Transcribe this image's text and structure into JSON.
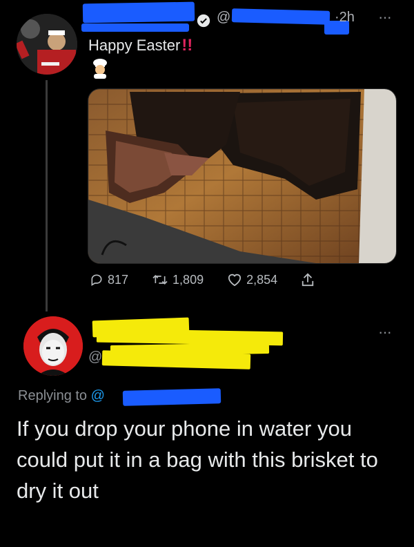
{
  "tweet1": {
    "handle_prefix": "@",
    "time": "·2h",
    "more": "···",
    "text": "Happy Easter",
    "emphasis": "!!",
    "chef_emoji": "cook-emoji",
    "photo_alt": "brisket-on-cutting-board",
    "stats": {
      "replies": "817",
      "retweets": "1,809",
      "likes": "2,854"
    },
    "icons": [
      "reply-icon",
      "retweet-icon",
      "like-icon",
      "share-icon"
    ]
  },
  "tweet2": {
    "handle_prefix": "@",
    "more": "···",
    "replying_to": "Replying to",
    "replying_at": "@",
    "text": "If you drop your phone in water you could put it in a bag with this brisket to dry it out"
  },
  "colors": {
    "background": "#000000",
    "text": "#e7e9ea",
    "muted": "#8b8f94",
    "redaction_blue": "#1a5cff",
    "redaction_yellow": "#f5ea0a",
    "link": "#1d9bf0",
    "alert_red": "#e0245e"
  }
}
